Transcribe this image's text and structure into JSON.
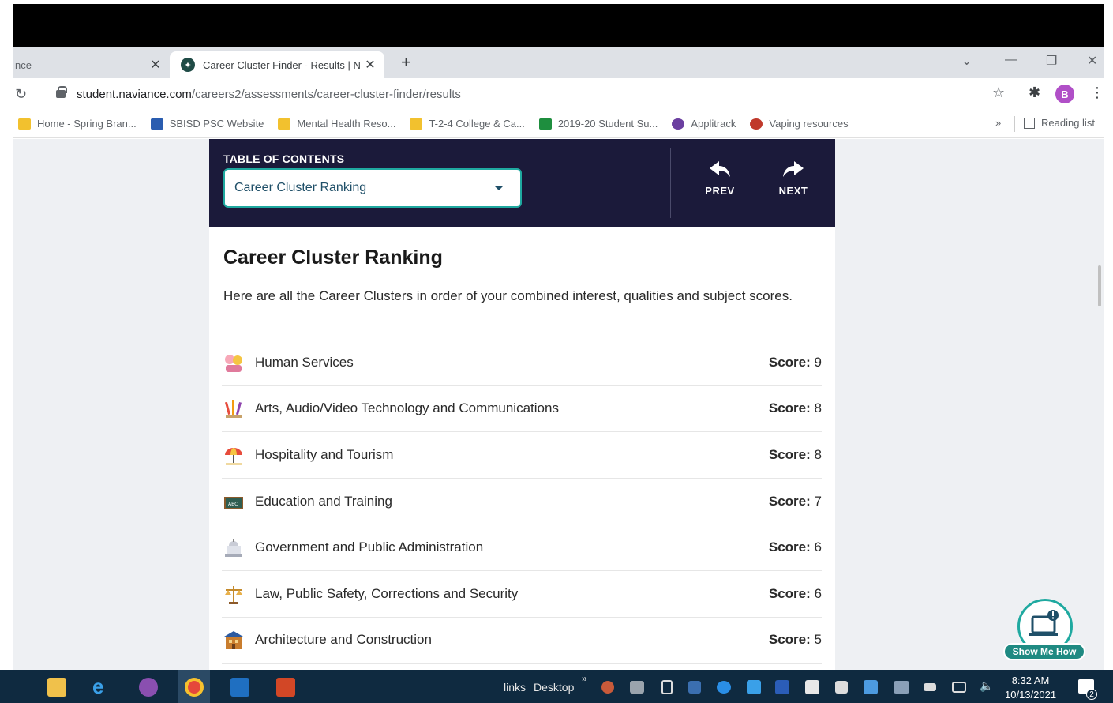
{
  "browser": {
    "tabs": [
      {
        "title": "nce",
        "active": false
      },
      {
        "title": "Career Cluster Finder - Results | N",
        "active": true
      }
    ],
    "url_host": "student.naviance.com",
    "url_path": "/careers2/assessments/career-cluster-finder/results",
    "avatar_initial": "B",
    "bookmarks": [
      {
        "label": "Home - Spring Bran...",
        "icon_color": "#f2c12e"
      },
      {
        "label": "SBISD PSC Website",
        "icon_color": "#2a5db0"
      },
      {
        "label": "Mental Health Reso...",
        "icon_color": "#f2c12e"
      },
      {
        "label": "T-2-4 College & Ca...",
        "icon_color": "#f2c12e"
      },
      {
        "label": "2019-20 Student Su...",
        "icon_color": "#1e8e3e"
      },
      {
        "label": "Applitrack",
        "icon_color": "#6b3fa0"
      },
      {
        "label": "Vaping resources",
        "icon_color": "#c0392b"
      }
    ],
    "bookmarks_overflow": "»",
    "reading_list": "Reading list"
  },
  "toc": {
    "label": "TABLE OF CONTENTS",
    "selected": "Career Cluster Ranking",
    "prev": "PREV",
    "next": "NEXT"
  },
  "main": {
    "heading": "Career Cluster Ranking",
    "intro": "Here are all the Career Clusters in order of your combined interest, qualities and subject scores.",
    "score_label": "Score:",
    "clusters": [
      {
        "name": "Human Services",
        "score": "9",
        "icon": "people-icon"
      },
      {
        "name": "Arts, Audio/Video Technology and Communications",
        "score": "8",
        "icon": "paint-brushes-icon"
      },
      {
        "name": "Hospitality and Tourism",
        "score": "8",
        "icon": "beach-umbrella-icon"
      },
      {
        "name": "Education and Training",
        "score": "7",
        "icon": "chalkboard-icon"
      },
      {
        "name": "Government and Public Administration",
        "score": "6",
        "icon": "capitol-icon"
      },
      {
        "name": "Law, Public Safety, Corrections and Security",
        "score": "6",
        "icon": "scales-icon"
      },
      {
        "name": "Architecture and Construction",
        "score": "5",
        "icon": "building-icon"
      }
    ]
  },
  "help": {
    "label": "Show Me How"
  },
  "taskbar": {
    "links_label": "links",
    "desktop_label": "Desktop",
    "overflow": "»",
    "time": "8:32 AM",
    "date": "10/13/2021",
    "notification_count": "2"
  }
}
